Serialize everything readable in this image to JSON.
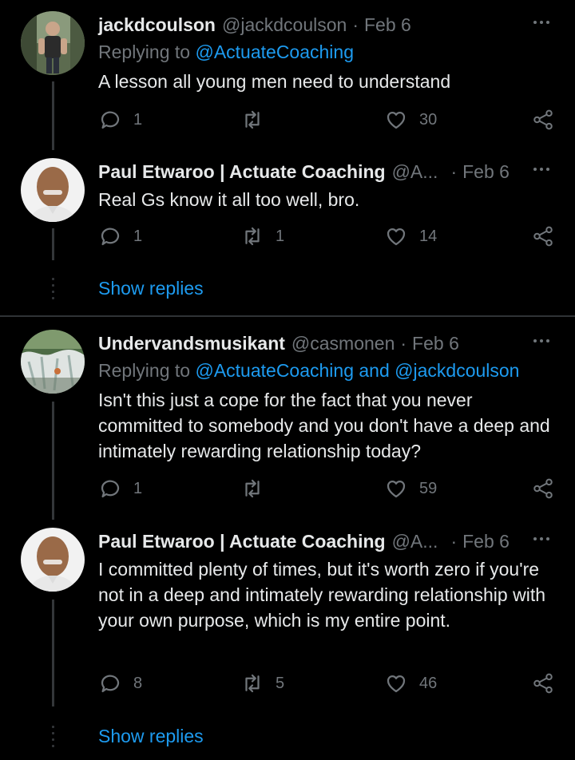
{
  "tweets": [
    {
      "name": "jackdcoulson",
      "handle": "@jackdcoulson",
      "sep": "·",
      "date": "Feb 6",
      "replying_prefix": "Replying to ",
      "replying_mentions": [
        "@ActuateCoaching"
      ],
      "replying_joiner": "",
      "text": "A lesson all young men need to understand",
      "reply_count": "1",
      "retweet_count": "",
      "like_count": "30"
    },
    {
      "name": "Paul Etwaroo | Actuate Coaching",
      "handle": "@A...",
      "sep": "·",
      "date": "Feb 6",
      "text": "Real Gs know it all too well, bro.",
      "reply_count": "1",
      "retweet_count": "1",
      "like_count": "14"
    },
    {
      "name": "Undervandsmusikant",
      "handle": "@casmonen",
      "sep": "·",
      "date": "Feb 6",
      "replying_prefix": "Replying to ",
      "replying_mentions": [
        "@ActuateCoaching",
        "@jackdcoulson"
      ],
      "replying_joiner": " and ",
      "text": "Isn't this just a cope for the fact that you never committed to somebody and you don't have a deep and intimately rewarding relationship today?",
      "reply_count": "1",
      "retweet_count": "",
      "like_count": "59"
    },
    {
      "name": "Paul Etwaroo | Actuate Coaching",
      "handle": "@A...",
      "sep": "·",
      "date": "Feb 6",
      "text": "I committed plenty of times, but it's worth zero if you're not in a deep and intimately rewarding relationship with your own purpose, which is my entire point.",
      "reply_count": "8",
      "retweet_count": "5",
      "like_count": "46"
    }
  ],
  "show_replies_label": "Show replies",
  "icons": [
    "more-icon",
    "reply-icon",
    "retweet-icon",
    "like-icon",
    "share-icon"
  ],
  "colors": {
    "background": "#000000",
    "text": "#e7e9ea",
    "muted": "#71767b",
    "link": "#1d9bf0",
    "line": "#333639"
  }
}
